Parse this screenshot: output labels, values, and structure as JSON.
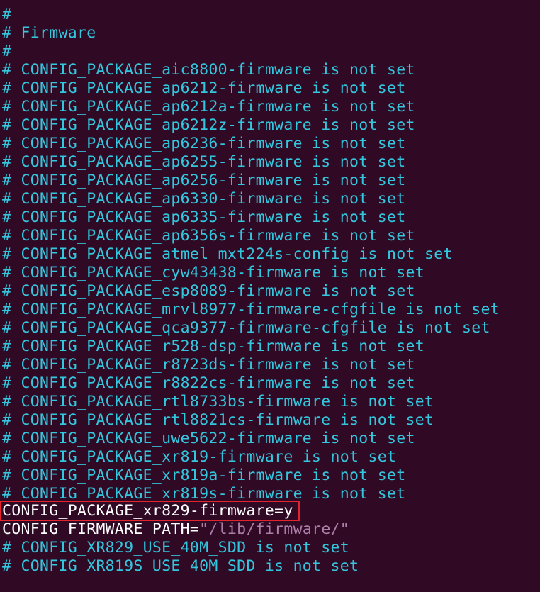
{
  "terminal": {
    "comment_lines": [
      "#",
      "# Firmware",
      "#",
      "# CONFIG_PACKAGE_aic8800-firmware is not set",
      "# CONFIG_PACKAGE_ap6212-firmware is not set",
      "# CONFIG_PACKAGE_ap6212a-firmware is not set",
      "# CONFIG_PACKAGE_ap6212z-firmware is not set",
      "# CONFIG_PACKAGE_ap6236-firmware is not set",
      "# CONFIG_PACKAGE_ap6255-firmware is not set",
      "# CONFIG_PACKAGE_ap6256-firmware is not set",
      "# CONFIG_PACKAGE_ap6330-firmware is not set",
      "# CONFIG_PACKAGE_ap6335-firmware is not set",
      "# CONFIG_PACKAGE_ap6356s-firmware is not set",
      "# CONFIG_PACKAGE_atmel_mxt224s-config is not set",
      "# CONFIG_PACKAGE_cyw43438-firmware is not set",
      "# CONFIG_PACKAGE_esp8089-firmware is not set",
      "# CONFIG_PACKAGE_mrvl8977-firmware-cfgfile is not set",
      "# CONFIG_PACKAGE_qca9377-firmware-cfgfile is not set",
      "# CONFIG_PACKAGE_r528-dsp-firmware is not set",
      "# CONFIG_PACKAGE_r8723ds-firmware is not set",
      "# CONFIG_PACKAGE_r8822cs-firmware is not set",
      "# CONFIG_PACKAGE_rtl8733bs-firmware is not set",
      "# CONFIG_PACKAGE_rtl8821cs-firmware is not set",
      "# CONFIG_PACKAGE_uwe5622-firmware is not set",
      "# CONFIG_PACKAGE_xr819-firmware is not set",
      "# CONFIG_PACKAGE_xr819a-firmware is not set",
      "# CONFIG_PACKAGE_xr819s-firmware is not set"
    ],
    "enabled_line": "CONFIG_PACKAGE_xr829-firmware=y",
    "path_line": {
      "key": "CONFIG_FIRMWARE_PATH=",
      "value": "\"/lib/firmware/\""
    },
    "trailing_lines": [
      "# CONFIG_XR829_USE_40M_SDD is not set",
      "# CONFIG_XR819S_USE_40M_SDD is not set"
    ]
  },
  "colors": {
    "background": "#300a24",
    "comment": "#33c7de",
    "plain_text": "#ffffff",
    "string": "#ad7fa8",
    "highlight_border": "#e2242d"
  }
}
